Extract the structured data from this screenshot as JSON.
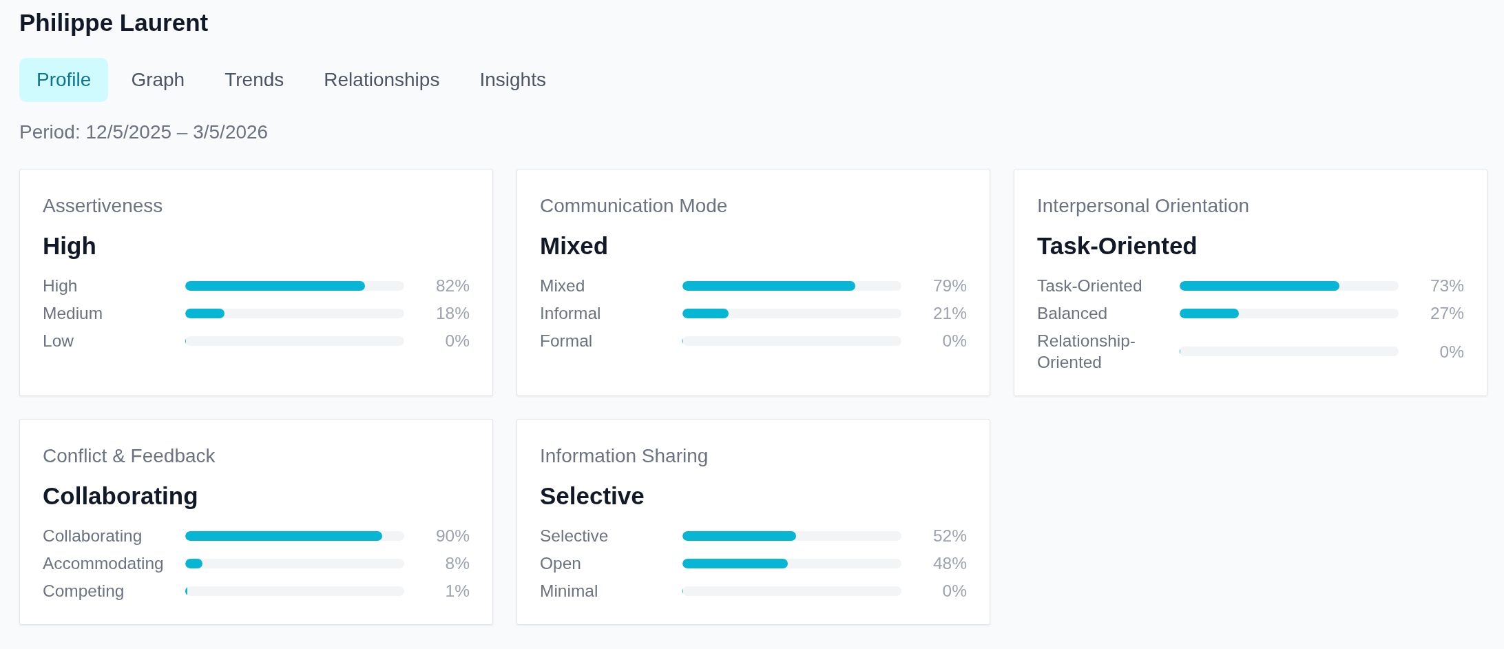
{
  "profile": {
    "name": "Philippe Laurent"
  },
  "tabs": [
    {
      "label": "Profile",
      "selected": true
    },
    {
      "label": "Graph",
      "selected": false
    },
    {
      "label": "Trends",
      "selected": false
    },
    {
      "label": "Relationships",
      "selected": false
    },
    {
      "label": "Insights",
      "selected": false
    }
  ],
  "period": "Period: 12/5/2025 – 3/5/2026",
  "cards": [
    {
      "title": "Assertiveness",
      "value": "High",
      "rows": [
        {
          "label": "High",
          "level": 0.82,
          "reading": "82%"
        },
        {
          "label": "Medium",
          "level": 0.18,
          "reading": "18%"
        },
        {
          "label": "Low",
          "level": 0,
          "reading": "0%"
        }
      ]
    },
    {
      "title": "Communication Mode",
      "value": "Mixed",
      "rows": [
        {
          "label": "Mixed",
          "level": 0.79,
          "reading": "79%"
        },
        {
          "label": "Informal",
          "level": 0.21,
          "reading": "21%"
        },
        {
          "label": "Formal",
          "level": 0,
          "reading": "0%"
        }
      ]
    },
    {
      "title": "Interpersonal Orientation",
      "value": "Task-Oriented",
      "rows": [
        {
          "label": "Task-Oriented",
          "level": 0.73,
          "reading": "73%"
        },
        {
          "label": "Balanced",
          "level": 0.27,
          "reading": "27%"
        },
        {
          "label": "Relationship-Oriented",
          "level": 0,
          "reading": "0%"
        }
      ]
    },
    {
      "title": "Conflict & Feedback",
      "value": "Collaborating",
      "rows": [
        {
          "label": "Collaborating",
          "level": 0.9,
          "reading": "90%"
        },
        {
          "label": "Accommodating",
          "level": 0.08,
          "reading": "8%"
        },
        {
          "label": "Competing",
          "level": 0.01,
          "reading": "1%"
        }
      ]
    },
    {
      "title": "Information Sharing",
      "value": "Selective",
      "rows": [
        {
          "label": "Selective",
          "level": 0.52,
          "reading": "52%"
        },
        {
          "label": "Open",
          "level": 0.48,
          "reading": "48%"
        },
        {
          "label": "Minimal",
          "level": 0,
          "reading": "0%"
        }
      ]
    }
  ]
}
